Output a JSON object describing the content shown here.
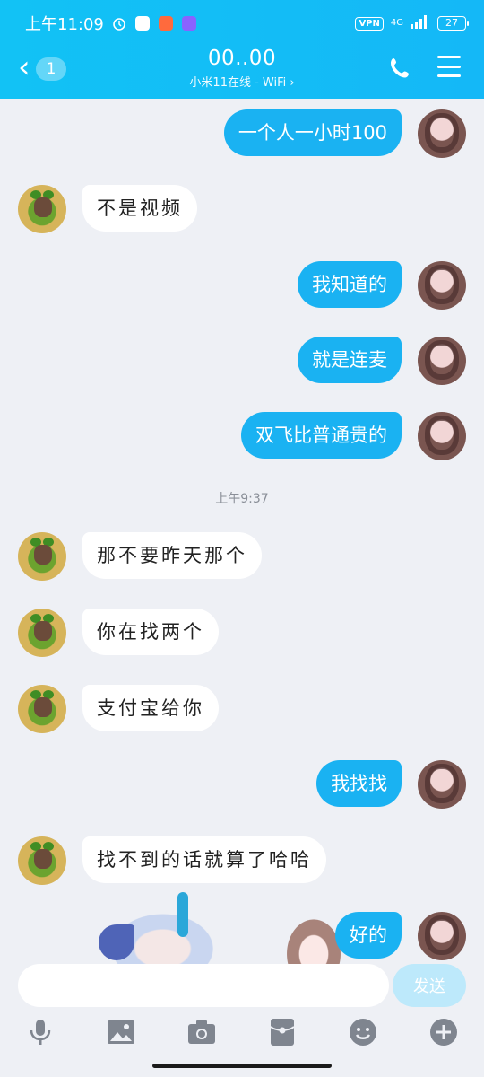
{
  "status_bar": {
    "time": "上午11:09",
    "vpn": "VPN",
    "network": "4G",
    "battery": "27"
  },
  "header": {
    "back_count": "1",
    "title": "00..00",
    "subtitle": "小米11在线 - WiFi ›"
  },
  "messages": [
    {
      "side": "right",
      "text": "一个人一小时100"
    },
    {
      "side": "left",
      "text": "不是视频"
    },
    {
      "side": "right",
      "text": "我知道的"
    },
    {
      "side": "right",
      "text": "就是连麦"
    },
    {
      "side": "right",
      "text": "双飞比普通贵的"
    },
    {
      "side": "left",
      "text": "那不要昨天那个"
    },
    {
      "side": "left",
      "text": "你在找两个"
    },
    {
      "side": "left",
      "text": "支付宝给你"
    },
    {
      "side": "right",
      "text": "我找找"
    },
    {
      "side": "left",
      "text": "找不到的话就算了哈哈"
    },
    {
      "side": "right",
      "text": "好的"
    }
  ],
  "timestamp": "上午9:37",
  "input": {
    "value": "",
    "placeholder": "",
    "send_label": "发送"
  },
  "toolbar": [
    "mic-icon",
    "image-icon",
    "camera-icon",
    "red-packet-icon",
    "emoji-icon",
    "plus-icon"
  ],
  "colors": {
    "header": "#14b8f7",
    "bubble_self": "#1ab2f2",
    "bubble_other": "#ffffff",
    "background": "#eef0f5",
    "send_disabled": "#bde9fb"
  }
}
